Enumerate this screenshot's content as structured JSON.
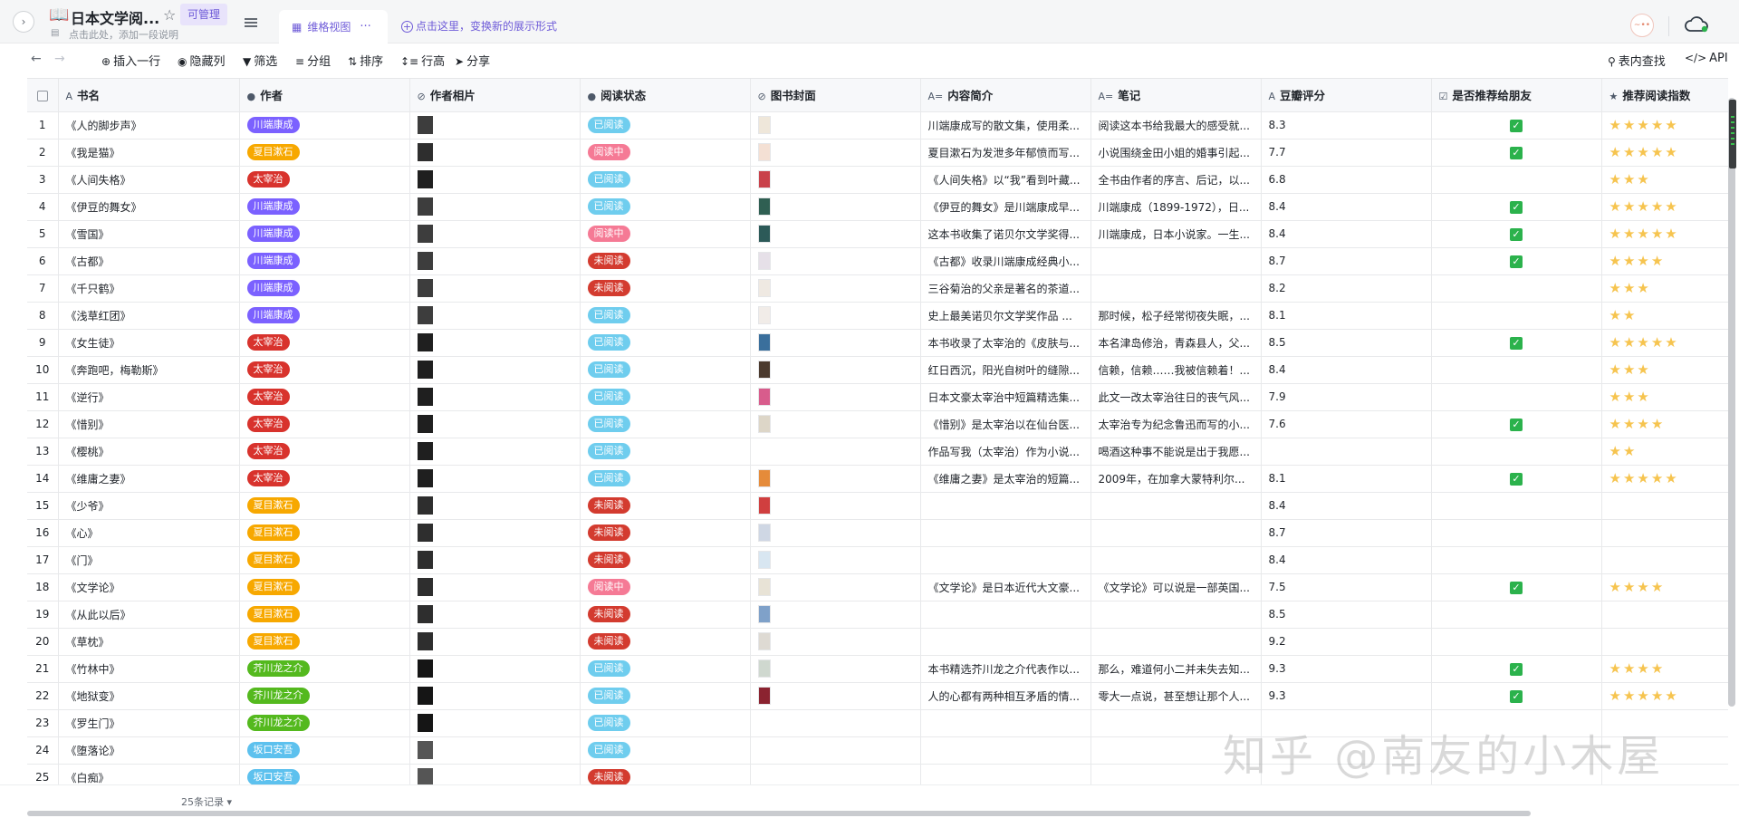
{
  "header": {
    "doc_icon": "📖",
    "title": "日本文学阅...",
    "permission": "可管理",
    "description": "点击此处，添加一段说明",
    "view_name": "维格视图",
    "view_more": "···",
    "add_view": "点击这里，变换新的展示形式",
    "avatar_text": "~••"
  },
  "toolbar": {
    "insert_row": "插入一行",
    "hide_cols": "隐藏列",
    "filter": "筛选",
    "group": "分组",
    "sort": "排序",
    "row_height": "行高",
    "share": "分享",
    "search": "表内查找",
    "api": "API"
  },
  "columns": [
    {
      "label": "书名",
      "icon": "A"
    },
    {
      "label": "作者",
      "icon": "●"
    },
    {
      "label": "作者相片",
      "icon": "⊘"
    },
    {
      "label": "阅读状态",
      "icon": "●"
    },
    {
      "label": "图书封面",
      "icon": "⊘"
    },
    {
      "label": "内容简介",
      "icon": "A="
    },
    {
      "label": "笔记",
      "icon": "A="
    },
    {
      "label": "豆瓣评分",
      "icon": "A"
    },
    {
      "label": "是否推荐给朋友",
      "icon": "☑"
    },
    {
      "label": "推荐阅读指数",
      "icon": "★"
    }
  ],
  "rows": [
    {
      "n": "1",
      "book": "《人的脚步声》",
      "author": "川端康成",
      "ac": "t-kw",
      "status": "已阅读",
      "sc": "s-done",
      "photo": "#3d3d3d",
      "cover": "#efe7da",
      "summary": "川端康成写的散文集，使用柔...",
      "note": "阅读这本书给我最大的感受就...",
      "score": "8.3",
      "rec": true,
      "stars": "⭐⭐⭐⭐⭐"
    },
    {
      "n": "2",
      "book": "《我是猫》",
      "author": "夏目漱石",
      "ac": "t-nt",
      "status": "阅读中",
      "sc": "s-ing",
      "photo": "#2e2e2e",
      "cover": "#f4e0d4",
      "summary": "夏目漱石为发泄多年郁愤而写...",
      "note": "小说围绕金田小姐的婚事引起...",
      "score": "7.7",
      "rec": true,
      "stars": "⭐⭐⭐⭐⭐"
    },
    {
      "n": "3",
      "book": "《人间失格》",
      "author": "太宰治",
      "ac": "t-tz",
      "status": "已阅读",
      "sc": "s-done",
      "photo": "#1f1f1f",
      "cover": "#c9414a",
      "summary": "《人间失格》以“我”看到叶藏...",
      "note": "全书由作者的序言、后记，以...",
      "score": "6.8",
      "rec": false,
      "stars": "⭐⭐⭐"
    },
    {
      "n": "4",
      "book": "《伊豆的舞女》",
      "author": "川端康成",
      "ac": "t-kw",
      "status": "已阅读",
      "sc": "s-done",
      "photo": "#3d3d3d",
      "cover": "#2f5f52",
      "summary": "《伊豆的舞女》是川端康成早...",
      "note": "川端康成（1899-1972），日...",
      "score": "8.4",
      "rec": true,
      "stars": "⭐⭐⭐⭐⭐"
    },
    {
      "n": "5",
      "book": "《雪国》",
      "author": "川端康成",
      "ac": "t-kw",
      "status": "阅读中",
      "sc": "s-ing",
      "photo": "#3d3d3d",
      "cover": "#2c5a58",
      "summary": "这本书收集了诺贝尔文学奖得...",
      "note": "川端康成，日本小说家。一生...",
      "score": "8.4",
      "rec": true,
      "stars": "⭐⭐⭐⭐⭐"
    },
    {
      "n": "6",
      "book": "《古都》",
      "author": "川端康成",
      "ac": "t-kw",
      "status": "未阅读",
      "sc": "s-not",
      "photo": "#3d3d3d",
      "cover": "#e6e0e8",
      "summary": "《古都》收录川端康成经典小...",
      "note": "",
      "score": "8.7",
      "rec": true,
      "stars": "⭐⭐⭐⭐"
    },
    {
      "n": "7",
      "book": "《千只鹤》",
      "author": "川端康成",
      "ac": "t-kw",
      "status": "未阅读",
      "sc": "s-not",
      "photo": "#3d3d3d",
      "cover": "#efe9e2",
      "summary": "三谷菊治的父亲是著名的茶道...",
      "note": "",
      "score": "8.2",
      "rec": false,
      "stars": "⭐⭐⭐"
    },
    {
      "n": "8",
      "book": "《浅草红团》",
      "author": "川端康成",
      "ac": "t-kw",
      "status": "已阅读",
      "sc": "s-done",
      "photo": "#3d3d3d",
      "cover": "#f1ece8",
      "summary": "史上最美诺贝尔文学奖作品 ...",
      "note": "那时候，松子经常彻夜失眠，...",
      "score": "8.1",
      "rec": false,
      "stars": "⭐⭐"
    },
    {
      "n": "9",
      "book": "《女生徒》",
      "author": "太宰治",
      "ac": "t-tz",
      "status": "已阅读",
      "sc": "s-done",
      "photo": "#1f1f1f",
      "cover": "#3a6f9c",
      "summary": "本书收录了太宰治的《皮肤与...",
      "note": "本名津岛修治，青森县人，父...",
      "score": "8.5",
      "rec": true,
      "stars": "⭐⭐⭐⭐⭐"
    },
    {
      "n": "10",
      "book": "《奔跑吧，梅勒斯》",
      "author": "太宰治",
      "ac": "t-tz",
      "status": "已阅读",
      "sc": "s-done",
      "photo": "#1f1f1f",
      "cover": "#4b3a2e",
      "summary": "红日西沉，阳光自树叶的缝隙...",
      "note": "信赖，信赖……我被信赖着！...",
      "score": "8.4",
      "rec": false,
      "stars": "⭐⭐⭐"
    },
    {
      "n": "11",
      "book": "《逆行》",
      "author": "太宰治",
      "ac": "t-tz",
      "status": "已阅读",
      "sc": "s-done",
      "photo": "#1f1f1f",
      "cover": "#d85c8c",
      "summary": "日本文豪太宰治中短篇精选集...",
      "note": "此文一改太宰治往日的丧气风...",
      "score": "7.9",
      "rec": false,
      "stars": "⭐⭐⭐"
    },
    {
      "n": "12",
      "book": "《惜别》",
      "author": "太宰治",
      "ac": "t-tz",
      "status": "已阅读",
      "sc": "s-done",
      "photo": "#1f1f1f",
      "cover": "#ddd6c8",
      "summary": "《惜别》是太宰治以在仙台医...",
      "note": "太宰治专为纪念鲁迅而写的小...",
      "score": "7.6",
      "rec": true,
      "stars": "⭐⭐⭐⭐"
    },
    {
      "n": "13",
      "book": "《樱桃》",
      "author": "太宰治",
      "ac": "t-tz",
      "status": "已阅读",
      "sc": "s-done",
      "photo": "#1f1f1f",
      "cover": "",
      "summary": "作品写我（太宰治）作为小说...",
      "note": "喝酒这种事不能说是出于我愿...",
      "score": "",
      "rec": false,
      "stars": "⭐⭐"
    },
    {
      "n": "14",
      "book": "《维庸之妻》",
      "author": "太宰治",
      "ac": "t-tz",
      "status": "已阅读",
      "sc": "s-done",
      "photo": "#1f1f1f",
      "cover": "#e58b3a",
      "summary": "《维庸之妻》是太宰治的短篇...",
      "note": "2009年，在加拿大蒙特利尔...",
      "score": "8.1",
      "rec": true,
      "stars": "⭐⭐⭐⭐⭐"
    },
    {
      "n": "15",
      "book": "《少爷》",
      "author": "夏目漱石",
      "ac": "t-nt",
      "status": "未阅读",
      "sc": "s-not",
      "photo": "#2e2e2e",
      "cover": "#d03f3f",
      "summary": "",
      "note": "",
      "score": "8.4",
      "rec": false,
      "stars": ""
    },
    {
      "n": "16",
      "book": "《心》",
      "author": "夏目漱石",
      "ac": "t-nt",
      "status": "未阅读",
      "sc": "s-not",
      "photo": "#2e2e2e",
      "cover": "#cfd7e4",
      "summary": "",
      "note": "",
      "score": "8.7",
      "rec": false,
      "stars": ""
    },
    {
      "n": "17",
      "book": "《门》",
      "author": "夏目漱石",
      "ac": "t-nt",
      "status": "未阅读",
      "sc": "s-not",
      "photo": "#2e2e2e",
      "cover": "#d8e6f1",
      "summary": "",
      "note": "",
      "score": "8.4",
      "rec": false,
      "stars": ""
    },
    {
      "n": "18",
      "book": "《文学论》",
      "author": "夏目漱石",
      "ac": "t-nt",
      "status": "阅读中",
      "sc": "s-ing",
      "photo": "#2e2e2e",
      "cover": "#e8e3d6",
      "summary": "《文学论》是日本近代大文豪...",
      "note": "《文学论》可以说是一部英国...",
      "score": "7.5",
      "rec": true,
      "stars": "⭐⭐⭐⭐"
    },
    {
      "n": "19",
      "book": "《从此以后》",
      "author": "夏目漱石",
      "ac": "t-nt",
      "status": "未阅读",
      "sc": "s-not",
      "photo": "#2e2e2e",
      "cover": "#7fa1c9",
      "summary": "",
      "note": "",
      "score": "8.5",
      "rec": false,
      "stars": ""
    },
    {
      "n": "20",
      "book": "《草枕》",
      "author": "夏目漱石",
      "ac": "t-nt",
      "status": "未阅读",
      "sc": "s-not",
      "photo": "#2e2e2e",
      "cover": "#dedad3",
      "summary": "",
      "note": "",
      "score": "9.2",
      "rec": false,
      "stars": ""
    },
    {
      "n": "21",
      "book": "《竹林中》",
      "author": "芥川龙之介",
      "ac": "t-rk",
      "status": "已阅读",
      "sc": "s-done",
      "photo": "#151515",
      "cover": "#cfd8cf",
      "summary": "本书精选芥川龙之介代表作以...",
      "note": "那么，难道何小二并未失去知...",
      "score": "9.3",
      "rec": true,
      "stars": "⭐⭐⭐⭐"
    },
    {
      "n": "22",
      "book": "《地狱变》",
      "author": "芥川龙之介",
      "ac": "t-rk",
      "status": "已阅读",
      "sc": "s-done",
      "photo": "#151515",
      "cover": "#8b2330",
      "summary": "人的心都有两种相互矛盾的情...",
      "note": "零大一点说，甚至想让那个人...",
      "score": "9.3",
      "rec": true,
      "stars": "⭐⭐⭐⭐⭐"
    },
    {
      "n": "23",
      "book": "《罗生门》",
      "author": "芥川龙之介",
      "ac": "t-rk",
      "status": "已阅读",
      "sc": "s-done",
      "photo": "#151515",
      "cover": "",
      "summary": "",
      "note": "",
      "score": "",
      "rec": false,
      "stars": ""
    },
    {
      "n": "24",
      "book": "《堕落论》",
      "author": "坂口安吾",
      "ac": "t-ak",
      "status": "已阅读",
      "sc": "s-done",
      "photo": "#555555",
      "cover": "",
      "summary": "",
      "note": "",
      "score": "",
      "rec": false,
      "stars": ""
    },
    {
      "n": "25",
      "book": "《白痴》",
      "author": "坂口安吾",
      "ac": "t-ak",
      "status": "未阅读",
      "sc": "s-not",
      "photo": "#555555",
      "cover": "",
      "summary": "",
      "note": "",
      "score": "",
      "rec": false,
      "stars": ""
    }
  ],
  "footer": {
    "record_count": "25条记录"
  },
  "watermark": "知乎 @南友的小木屋"
}
